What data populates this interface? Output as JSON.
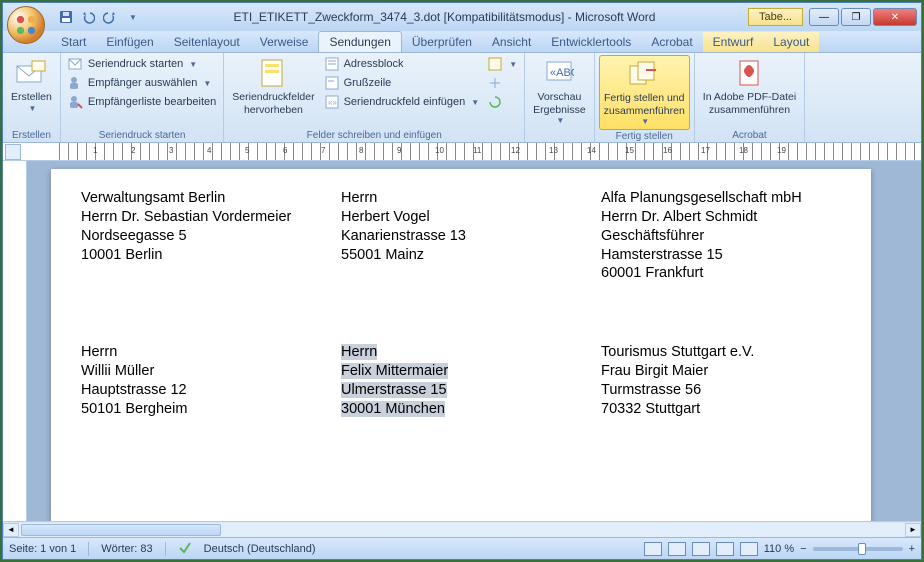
{
  "title": "ETI_ETIKETT_Zweckform_3474_3.dot [Kompatibilitätsmodus] - Microsoft Word",
  "tabe": "Tabe...",
  "tabs": [
    "Start",
    "Einfügen",
    "Seitenlayout",
    "Verweise",
    "Sendungen",
    "Überprüfen",
    "Ansicht",
    "Entwicklertools",
    "Acrobat",
    "Entwurf",
    "Layout"
  ],
  "active_tab_index": 4,
  "ribbon": {
    "g1": {
      "label": "Erstellen",
      "btn": "Erstellen"
    },
    "g2": {
      "label": "Seriendruck starten",
      "items": [
        "Seriendruck starten",
        "Empfänger auswählen",
        "Empfängerliste bearbeiten"
      ]
    },
    "g3": {
      "label": "Felder schreiben und einfügen",
      "big": "Seriendruckfelder\nhervorheben",
      "items": [
        "Adressblock",
        "Grußzeile",
        "Seriendruckfeld einfügen"
      ]
    },
    "g4": {
      "label": "",
      "btn": "Vorschau\nErgebnisse"
    },
    "g5": {
      "label": "Fertig stellen",
      "btn": "Fertig stellen und\nzusammenführen"
    },
    "g6": {
      "label": "Acrobat",
      "btn": "In Adobe PDF-Datei\nzusammenführen"
    }
  },
  "ruler_numbers": [
    "1",
    "2",
    "3",
    "4",
    "5",
    "6",
    "7",
    "8",
    "9",
    "10",
    "11",
    "12",
    "13",
    "14",
    "15",
    "16",
    "17",
    "18",
    "19"
  ],
  "labels": [
    [
      "Verwaltungsamt Berlin",
      "Herrn Dr. Sebastian Vordermeier",
      "Nordseegasse 5",
      "10001 Berlin"
    ],
    [
      "Herrn",
      "Herbert Vogel",
      "Kanarienstrasse 13",
      "55001 Mainz"
    ],
    [
      "Alfa Planungsgesellschaft mbH",
      "Herrn Dr. Albert Schmidt",
      "Geschäftsführer",
      "Hamsterstrasse 15",
      "60001 Frankfurt"
    ],
    [
      "Herrn",
      "Willii Müller",
      "Hauptstrasse 12",
      "50101 Bergheim"
    ],
    [
      "Herrn",
      "Felix Mittermaier",
      "Ulmerstrasse 15",
      "30001 München"
    ],
    [
      "Tourismus Stuttgart e.V.",
      "Frau Birgit Maier",
      "Turmstrasse 56",
      "70332 Stuttgart"
    ]
  ],
  "selected_label_index": 4,
  "status": {
    "page": "Seite: 1 von 1",
    "words": "Wörter: 83",
    "lang": "Deutsch (Deutschland)",
    "zoom": "110 %"
  }
}
